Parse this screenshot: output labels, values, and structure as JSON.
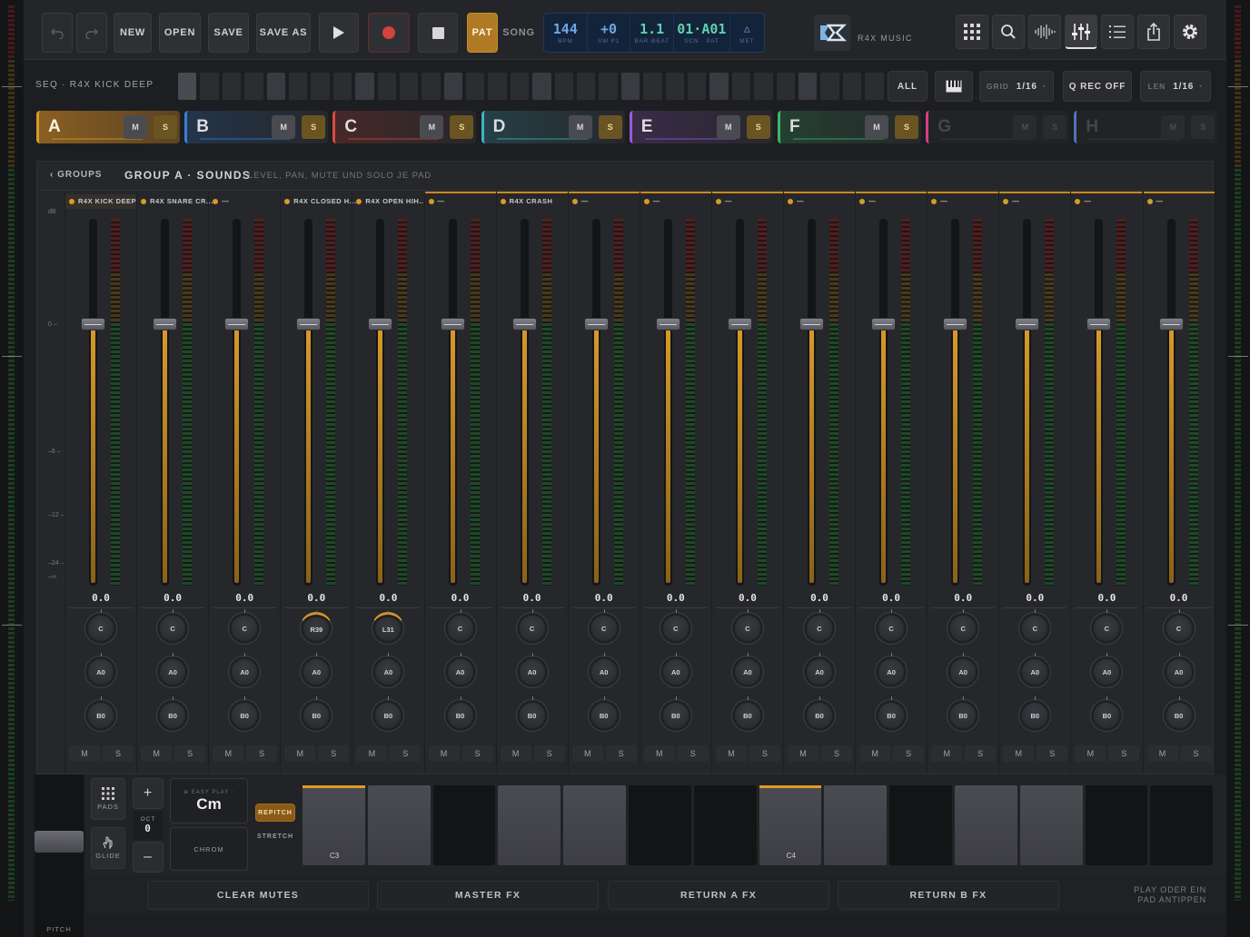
{
  "transport": {
    "new_label": "NEW",
    "open_label": "OPEN",
    "save_label": "SAVE",
    "saveas_label": "SAVE AS",
    "pat_label": "PAT",
    "song_label": "SONG"
  },
  "lcd": [
    {
      "value": "144",
      "label": "BPM"
    },
    {
      "value": "+0",
      "label": "SW P1"
    },
    {
      "value": "1.1",
      "label": "BAR·BEAT"
    },
    {
      "value": "01·A01",
      "label": "SCN · PAT"
    },
    {
      "value": "△",
      "label": "MET"
    }
  ],
  "brand": "R4X MUSIC",
  "seq": {
    "label": "SEQ · R4X KICK DEEP",
    "all_label": "ALL",
    "grid_label": "GRID",
    "grid_value": "1/16",
    "qrec_label": "Q REC OFF",
    "len_label": "LEN",
    "len_value": "1/16"
  },
  "groups": [
    {
      "letter": "A",
      "color": "#d79b27"
    },
    {
      "letter": "B",
      "color": "#3a7fd4"
    },
    {
      "letter": "C",
      "color": "#d84a3e"
    },
    {
      "letter": "D",
      "color": "#3fb3c6"
    },
    {
      "letter": "E",
      "color": "#9a5bd3"
    },
    {
      "letter": "F",
      "color": "#3db56a"
    },
    {
      "letter": "G",
      "color": "#d83c86"
    },
    {
      "letter": "H",
      "color": "#4f74b8"
    }
  ],
  "group_buttons": {
    "mute": "M",
    "solo": "S"
  },
  "panel": {
    "back_label": "‹ GROUPS",
    "title": "GROUP A · SOUNDS",
    "subtitle": "LEVEL, PAN, MUTE UND SOLO JE PAD"
  },
  "db_scale": [
    "dB",
    "0 –",
    "–6 –",
    "–12 –",
    "–24 –",
    "–∞"
  ],
  "channels": [
    {
      "name": "R4X KICK DEEP",
      "value": "0.0",
      "pan": "C",
      "send_a": "A0",
      "send_b": "B0"
    },
    {
      "name": "R4X SNARE CR...",
      "value": "0.0",
      "pan": "C",
      "send_a": "A0",
      "send_b": "B0"
    },
    {
      "name": "—",
      "value": "0.0",
      "pan": "C",
      "send_a": "A0",
      "send_b": "B0"
    },
    {
      "name": "R4X CLOSED H...",
      "value": "0.0",
      "pan": "R39",
      "send_a": "A0",
      "send_b": "B0"
    },
    {
      "name": "R4X OPEN HIH...",
      "value": "0.0",
      "pan": "L31",
      "send_a": "A0",
      "send_b": "B0"
    },
    {
      "name": "—",
      "value": "0.0",
      "pan": "C",
      "send_a": "A0",
      "send_b": "B0"
    },
    {
      "name": "R4X CRASH",
      "value": "0.0",
      "pan": "C",
      "send_a": "A0",
      "send_b": "B0"
    },
    {
      "name": "—",
      "value": "0.0",
      "pan": "C",
      "send_a": "A0",
      "send_b": "B0"
    },
    {
      "name": "—",
      "value": "0.0",
      "pan": "C",
      "send_a": "A0",
      "send_b": "B0"
    },
    {
      "name": "—",
      "value": "0.0",
      "pan": "C",
      "send_a": "A0",
      "send_b": "B0"
    },
    {
      "name": "—",
      "value": "0.0",
      "pan": "C",
      "send_a": "A0",
      "send_b": "B0"
    },
    {
      "name": "—",
      "value": "0.0",
      "pan": "C",
      "send_a": "A0",
      "send_b": "B0"
    },
    {
      "name": "—",
      "value": "0.0",
      "pan": "C",
      "send_a": "A0",
      "send_b": "B0"
    },
    {
      "name": "—",
      "value": "0.0",
      "pan": "C",
      "send_a": "A0",
      "send_b": "B0"
    },
    {
      "name": "—",
      "value": "0.0",
      "pan": "C",
      "send_a": "A0",
      "send_b": "B0"
    },
    {
      "name": "—",
      "value": "0.0",
      "pan": "C",
      "send_a": "A0",
      "send_b": "B0"
    }
  ],
  "channel_buttons": {
    "mute": "M",
    "solo": "S"
  },
  "keyboard": {
    "pads_label": "PADS",
    "glide_label": "GLIDE",
    "oct_label": "OCT",
    "oct_value": "0",
    "plus": "+",
    "minus": "–",
    "easy_play_label": "⊕ EASY PLAY ◦",
    "scale_value": "Cm",
    "chrom_label": "CHROM",
    "repitch_label": "REPITCH",
    "stretch_label": "STRETCH",
    "c3_label": "C3",
    "c4_label": "C4",
    "pitch_label": "PITCH"
  },
  "footer": {
    "clear_mutes": "CLEAR MUTES",
    "master_fx": "MASTER FX",
    "return_a": "RETURN A FX",
    "return_b": "RETURN B FX",
    "hint_line1": "PLAY ODER EIN",
    "hint_line2": "PAD ANTIPPEN"
  }
}
